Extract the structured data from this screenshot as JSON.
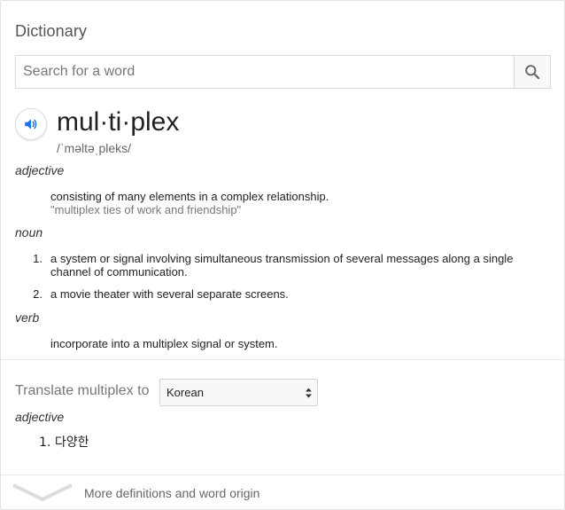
{
  "card": {
    "title": "Dictionary"
  },
  "search": {
    "placeholder": "Search for a word",
    "value": ""
  },
  "entry": {
    "headword": "mul·ti·plex",
    "phonetic": "/ˈməltəˌpleks/",
    "sections": [
      {
        "pos": "adjective",
        "definitions": [
          {
            "number": "",
            "text": "consisting of many elements in a complex relationship.",
            "example": "\"multiplex ties of work and friendship\""
          }
        ]
      },
      {
        "pos": "noun",
        "definitions": [
          {
            "number": "1.",
            "text": "a system or signal involving simultaneous transmission of several messages along a single channel of communication."
          },
          {
            "number": "2.",
            "text": "a movie theater with several separate screens."
          }
        ]
      },
      {
        "pos": "verb",
        "definitions": [
          {
            "number": "",
            "text": "incorporate into a multiplex signal or system."
          }
        ]
      }
    ]
  },
  "translate": {
    "label": "Translate multiplex to",
    "selected_language": "Korean",
    "pos": "adjective",
    "results": [
      {
        "number": "1.",
        "text": "다양한"
      }
    ]
  },
  "footer": {
    "more_label": "More definitions and word origin"
  },
  "colors": {
    "speaker_icon": "#1a73e8",
    "search_icon": "#5f6368",
    "chevron": "#dadce0"
  },
  "icons": {
    "speaker": "speaker-icon",
    "search": "search-icon",
    "select_arrows": "select-arrows-icon",
    "expand": "chevron-down-icon"
  }
}
